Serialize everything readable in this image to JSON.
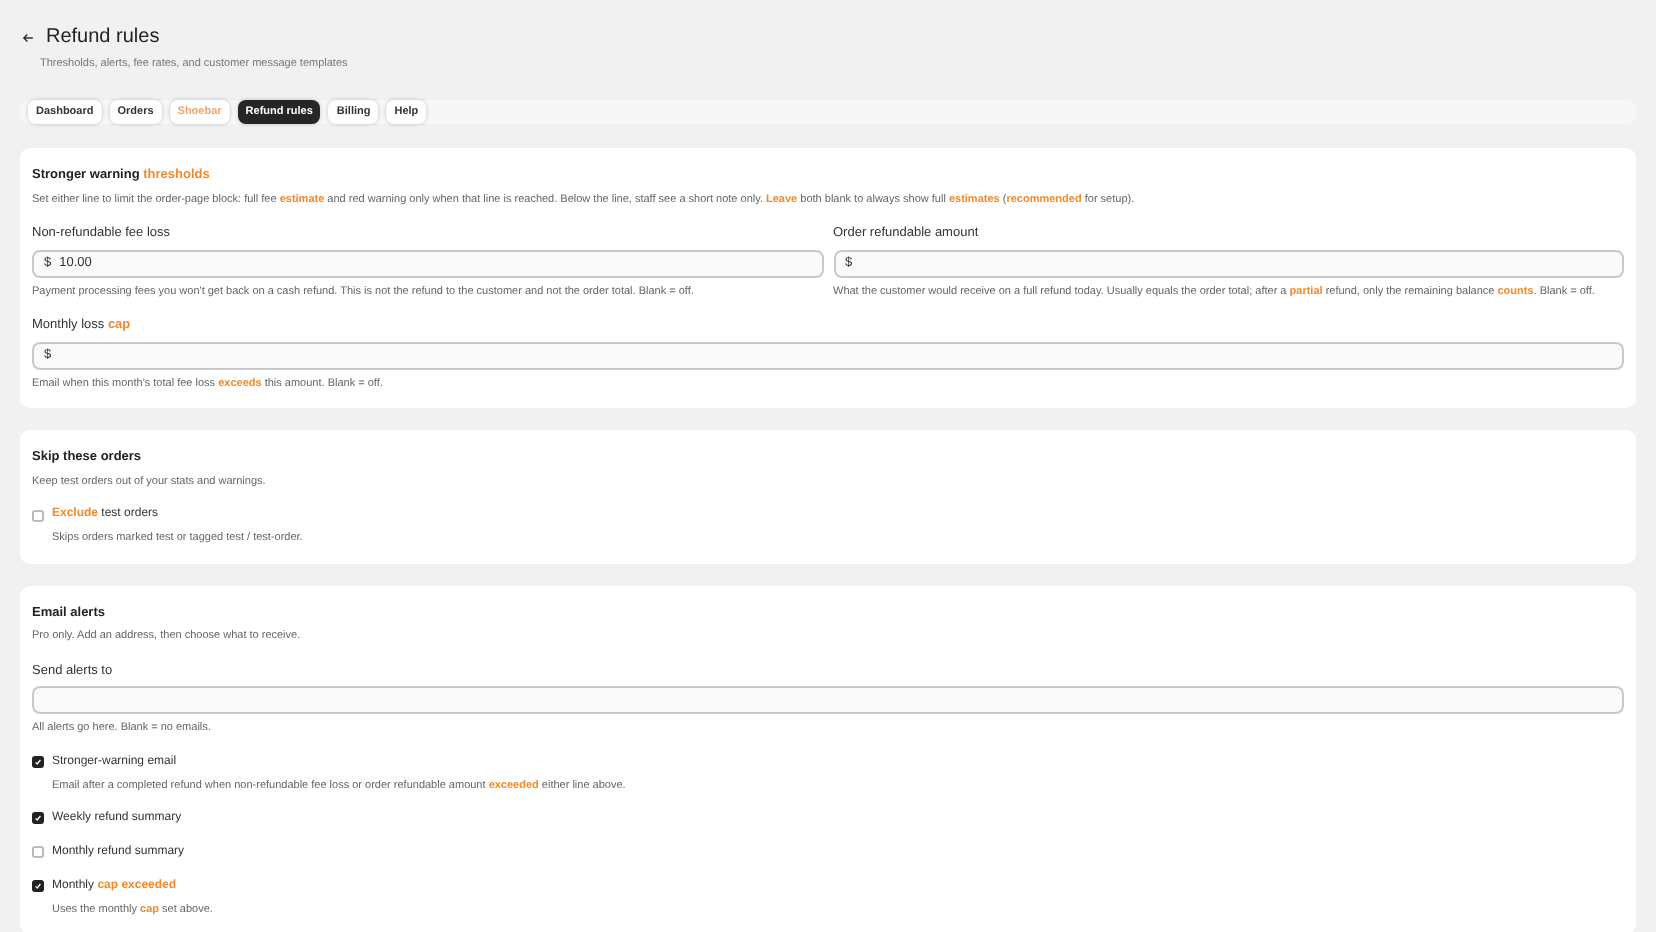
{
  "header": {
    "title": "Refund rules",
    "subtitle": "Thresholds, alerts, fee rates, and customer message templates"
  },
  "tabs": [
    {
      "label": "Dashboard",
      "selected": false,
      "highlight": false
    },
    {
      "label": "Orders",
      "selected": false,
      "highlight": false
    },
    {
      "label": "Shoebar",
      "selected": false,
      "highlight": true
    },
    {
      "label": "Refund rules",
      "selected": true,
      "highlight": false
    },
    {
      "label": "Billing",
      "selected": false,
      "highlight": false
    },
    {
      "label": "Help",
      "selected": false,
      "highlight": false
    }
  ],
  "sections": [
    {
      "title": [
        {
          "text": "Stronger warning ",
          "highlight": false
        },
        {
          "text": "thresholds",
          "highlight": true
        }
      ],
      "description": [
        {
          "text": "Set either line to limit the order-page block: full fee ",
          "highlight": false
        },
        {
          "text": "estimate",
          "highlight": true
        },
        {
          "text": " and red warning only when that line is reached. Below the line, staff see a short note only. ",
          "highlight": false
        },
        {
          "text": "Leave",
          "highlight": true
        },
        {
          "text": " both blank to always show full ",
          "highlight": false
        },
        {
          "text": "estimates",
          "highlight": true
        },
        {
          "text": " (",
          "highlight": false
        },
        {
          "text": "recommended",
          "highlight": true
        },
        {
          "text": " for setup).",
          "highlight": false
        }
      ],
      "rows": [
        [
          {
            "kind": "field",
            "label": [
              {
                "text": "Non-refundable fee loss",
                "highlight": false
              }
            ],
            "prefix": "$",
            "value": "10.00",
            "help": [
              {
                "text": "Payment processing fees you won't get back on a cash refund. This is not the refund to the customer and not the order total. Blank = off.",
                "highlight": false
              }
            ]
          },
          {
            "kind": "field",
            "label": [
              {
                "text": "Order refundable amount",
                "highlight": false
              }
            ],
            "prefix": "$",
            "help": [
              {
                "text": "What the customer would receive on a full refund today. Usually equals the order total; after a ",
                "highlight": false
              },
              {
                "text": "partial",
                "highlight": true
              },
              {
                "text": " refund, only the remaining balance ",
                "highlight": false
              },
              {
                "text": "counts",
                "highlight": true
              },
              {
                "text": ". Blank = off.",
                "highlight": false
              }
            ]
          }
        ],
        [
          {
            "kind": "field",
            "label": [
              {
                "text": "Monthly loss ",
                "highlight": false
              },
              {
                "text": "cap",
                "highlight": true
              }
            ],
            "prefix": "$",
            "help": [
              {
                "text": "Email when this month's total fee loss ",
                "highlight": false
              },
              {
                "text": "exceeds",
                "highlight": true
              },
              {
                "text": " this amount. Blank = off.",
                "highlight": false
              }
            ]
          }
        ]
      ]
    },
    {
      "title": [
        {
          "text": "Skip these orders",
          "highlight": false
        }
      ],
      "description": [
        {
          "text": "Keep test orders out of your stats and warnings.",
          "highlight": false
        }
      ],
      "rows": [
        [
          {
            "kind": "checkbox",
            "checked": false,
            "label": [
              {
                "text": "Exclude",
                "highlight": true
              },
              {
                "text": " test orders",
                "highlight": false
              }
            ],
            "help": [
              {
                "text": "Skips orders marked test or tagged test / test-order.",
                "highlight": false
              }
            ]
          }
        ]
      ]
    },
    {
      "title": [
        {
          "text": "Email alerts",
          "highlight": false
        }
      ],
      "description": [
        {
          "text": "Pro only. Add an address, then choose what to receive.",
          "highlight": false
        }
      ],
      "rows": [
        [
          {
            "kind": "field",
            "label": [
              {
                "text": "Send alerts to",
                "highlight": false
              }
            ],
            "help": [
              {
                "text": "All alerts go here. Blank = no emails.",
                "highlight": false
              }
            ]
          }
        ],
        [
          {
            "kind": "checkbox",
            "checked": true,
            "label": [
              {
                "text": "Stronger-warning email",
                "highlight": false
              }
            ],
            "help": [
              {
                "text": "Email after a completed refund when non-refundable fee loss or order refundable amount ",
                "highlight": false
              },
              {
                "text": "exceeded",
                "highlight": true
              },
              {
                "text": " either line above.",
                "highlight": false
              }
            ]
          }
        ],
        [
          {
            "kind": "checkbox",
            "checked": true,
            "label": [
              {
                "text": "Weekly refund summary",
                "highlight": false
              }
            ]
          }
        ],
        [
          {
            "kind": "checkbox",
            "checked": false,
            "label": [
              {
                "text": "Monthly refund summary",
                "highlight": false
              }
            ]
          }
        ],
        [
          {
            "kind": "checkbox",
            "checked": true,
            "label": [
              {
                "text": "Monthly ",
                "highlight": false
              },
              {
                "text": "cap exceeded",
                "highlight": true
              }
            ],
            "help": [
              {
                "text": "Uses the monthly ",
                "highlight": false
              },
              {
                "text": "cap",
                "highlight": true
              },
              {
                "text": " set above.",
                "highlight": false
              }
            ]
          }
        ]
      ]
    }
  ]
}
